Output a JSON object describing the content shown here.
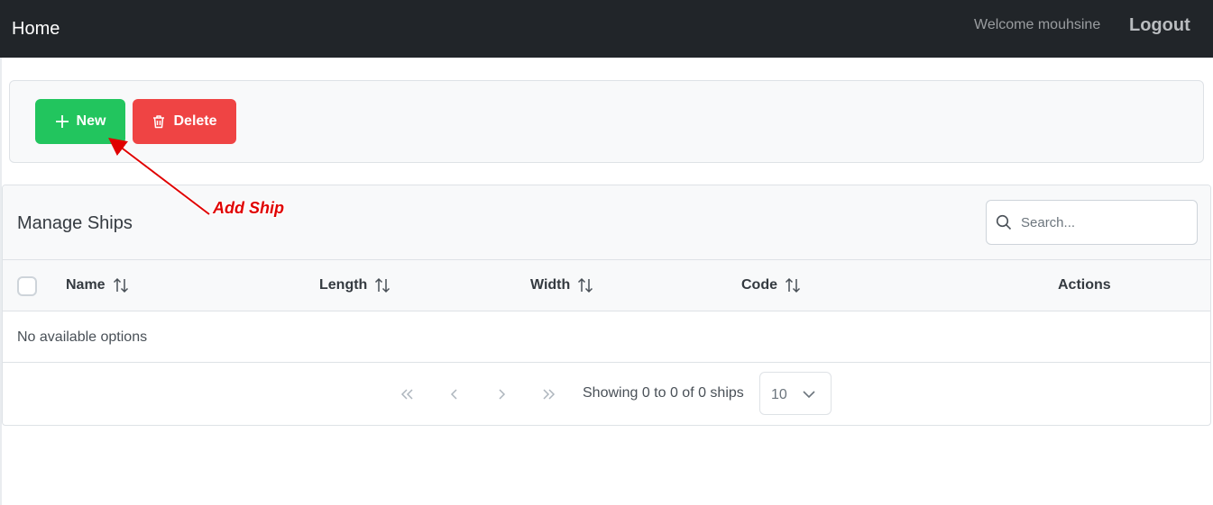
{
  "navbar": {
    "brand": "Home",
    "welcome": "Welcome mouhsine",
    "logout": "Logout"
  },
  "toolbar": {
    "new_label": "New",
    "delete_label": "Delete",
    "new_icon": "plus-icon",
    "delete_icon": "trash-icon"
  },
  "annotation": {
    "label": "Add Ship",
    "color": "#e00000"
  },
  "table": {
    "title": "Manage Ships",
    "search_placeholder": "Search...",
    "columns": [
      {
        "label": "Name",
        "sortable": true
      },
      {
        "label": "Length",
        "sortable": true
      },
      {
        "label": "Width",
        "sortable": true
      },
      {
        "label": "Code",
        "sortable": true
      },
      {
        "label": "Actions",
        "sortable": false
      }
    ],
    "empty_message": "No available options"
  },
  "paginator": {
    "info": "Showing 0 to 0 of 0 ships",
    "rows_per_page": "10"
  },
  "colors": {
    "navbar_bg": "#212529",
    "new_button": "#22c55e",
    "delete_button": "#ef4444"
  }
}
